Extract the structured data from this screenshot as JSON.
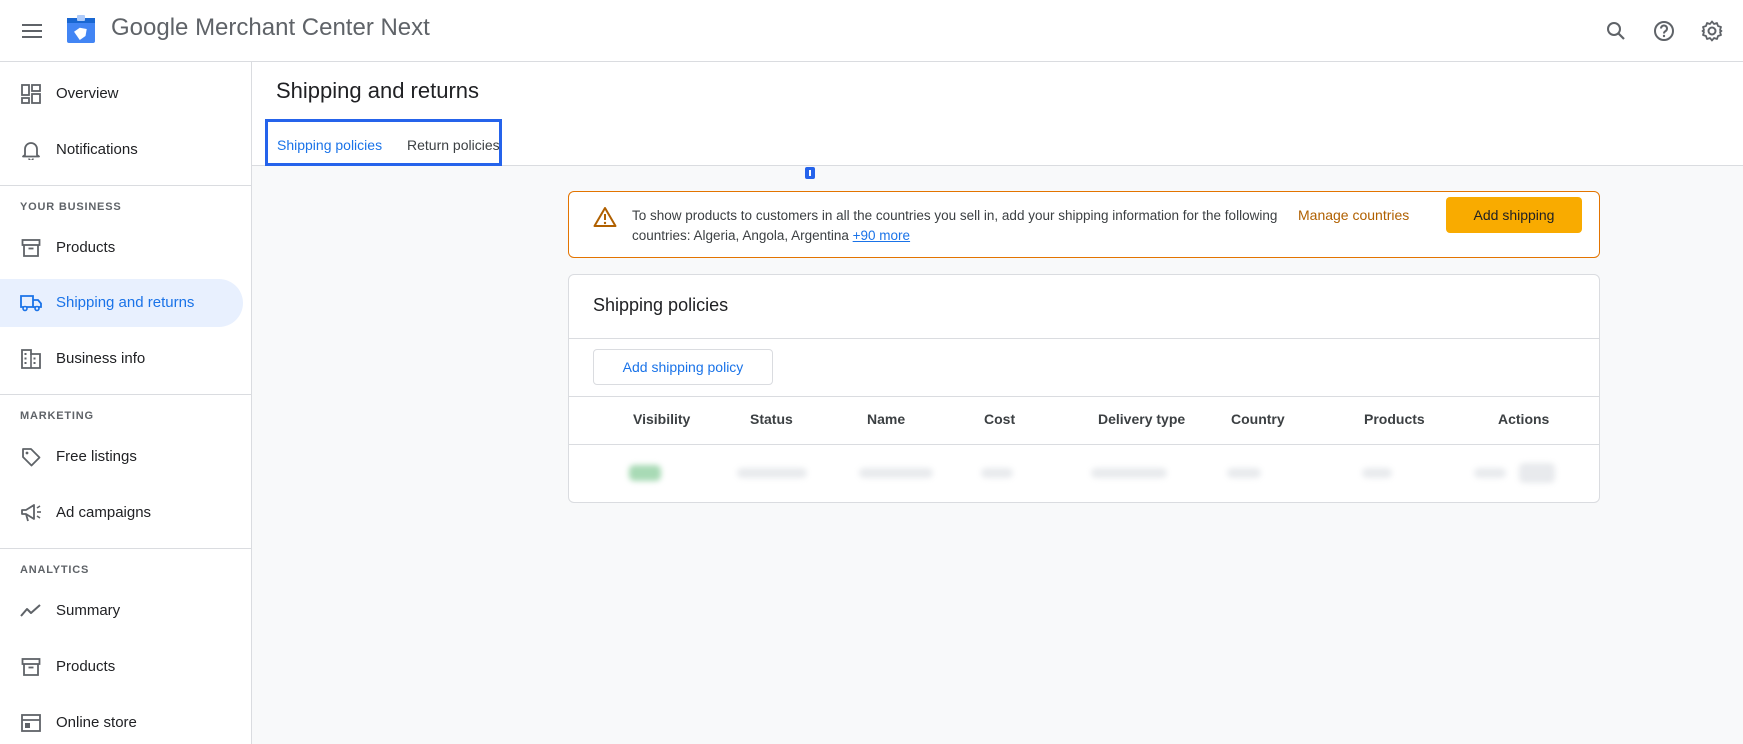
{
  "app": {
    "brand": "Google",
    "product": "Merchant Center Next"
  },
  "topbar": {
    "icons": [
      "menu-icon",
      "search-icon",
      "help-icon",
      "settings-icon"
    ]
  },
  "sidebar": {
    "items_top": [
      {
        "label": "Overview",
        "icon": "dashboard-icon"
      },
      {
        "label": "Notifications",
        "icon": "bell-icon"
      }
    ],
    "section_business": "YOUR BUSINESS",
    "items_business": [
      {
        "label": "Products",
        "icon": "archive-icon"
      },
      {
        "label": "Shipping and returns",
        "icon": "truck-icon"
      },
      {
        "label": "Business info",
        "icon": "building-icon"
      }
    ],
    "section_marketing": "MARKETING",
    "items_marketing": [
      {
        "label": "Free listings",
        "icon": "tag-icon"
      },
      {
        "label": "Ad campaigns",
        "icon": "megaphone-icon"
      }
    ],
    "section_analytics": "ANALYTICS",
    "items_analytics": [
      {
        "label": "Summary",
        "icon": "trend-icon"
      },
      {
        "label": "Products",
        "icon": "archive-icon"
      },
      {
        "label": "Online store",
        "icon": "store-icon"
      }
    ]
  },
  "page": {
    "title": "Shipping and returns",
    "tabs": [
      {
        "label": "Shipping policies",
        "active": true
      },
      {
        "label": "Return policies",
        "active": false
      }
    ]
  },
  "banner": {
    "message": "To show products to customers in all the countries you sell in, add your shipping information for the following countries: Algeria, Angola, Argentina ",
    "more_link": "+90 more",
    "manage_label": "Manage countries",
    "add_label": "Add shipping",
    "accent_color": "#e37400",
    "button_color": "#f9ab00"
  },
  "card": {
    "title": "Shipping policies",
    "add_policy_label": "Add shipping policy",
    "columns": [
      "Visibility",
      "Status",
      "Name",
      "Cost",
      "Delivery type",
      "Country",
      "Products",
      "Actions"
    ]
  },
  "colors": {
    "accent": "#1a73e8",
    "active_bg": "#e8f0fe",
    "highlight_box": "#2563eb"
  }
}
